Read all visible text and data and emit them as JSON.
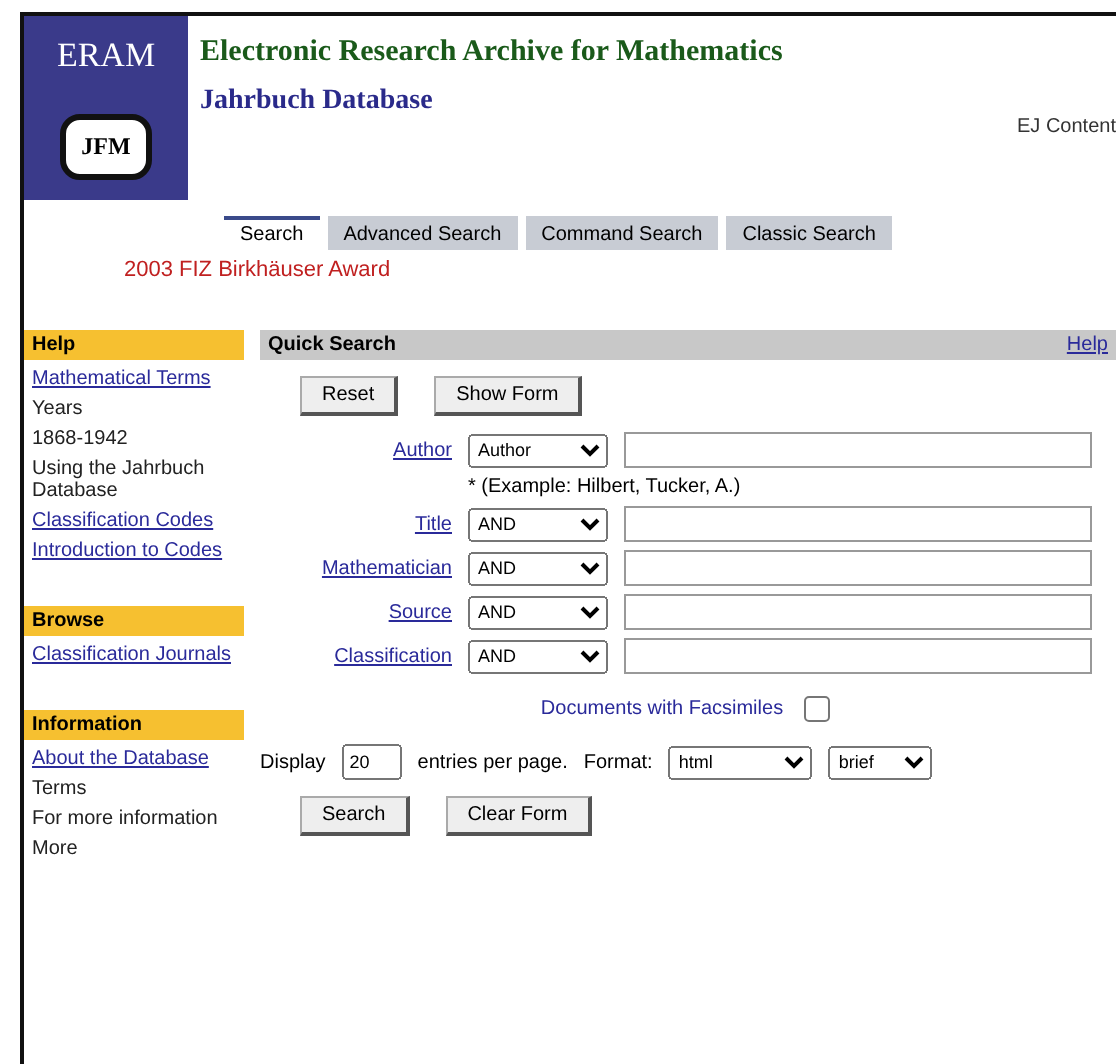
{
  "header": {
    "logo_top": "ERAM",
    "logo_bottom": "JFM",
    "title": "Electronic Research Archive for Mathematics",
    "subtitle": "Jahrbuch Database",
    "corner_link": "EJ Content"
  },
  "tabs": [
    {
      "label": "Search",
      "selected": true
    },
    {
      "label": "Advanced Search",
      "selected": false
    },
    {
      "label": "Command Search",
      "selected": false
    },
    {
      "label": "Classic Search",
      "selected": false
    }
  ],
  "notice": "2003 FIZ Birkhäuser Award",
  "sidebar": [
    {
      "heading": "Help",
      "items": [
        {
          "text": "Mathematical Terms",
          "link": true
        },
        {
          "text": "Years",
          "link": false
        },
        {
          "text": "1868-1942",
          "link": false
        },
        {
          "text": "Using the Jahrbuch Database",
          "link": false
        },
        {
          "text": "Classification Codes",
          "link": true
        },
        {
          "text": "Introduction to Codes",
          "link": true
        }
      ]
    },
    {
      "heading": "Browse",
      "items": [
        {
          "text": "Classification Journals",
          "link": true
        }
      ]
    },
    {
      "heading": "Information",
      "items": [
        {
          "text": "About the Database",
          "link": true
        },
        {
          "text": "Terms",
          "link": false
        },
        {
          "text": "For more information",
          "link": false
        },
        {
          "text": "More",
          "link": false
        }
      ]
    }
  ],
  "panel": {
    "title": "Quick Search",
    "corner": "Help",
    "buttons": [
      "Reset",
      "Show Form"
    ],
    "fields": [
      {
        "label": "Author",
        "operator": "Author",
        "hint": "* (Example: Hilbert, Tucker, A.)"
      },
      {
        "label": "Title",
        "operator": "AND"
      },
      {
        "label": "Mathematician",
        "operator": "AND"
      },
      {
        "label": "Source",
        "operator": "AND"
      },
      {
        "label": "Classification",
        "operator": "AND"
      }
    ],
    "facsimile_label": "Documents with Facsimiles",
    "facsimile_checked": false,
    "display_label": "Display",
    "display_value": "20",
    "per_page": "entries per page.",
    "format_label": "Format:",
    "format_values": [
      "html",
      "brief"
    ],
    "actions": [
      "Search",
      "Clear Form"
    ]
  }
}
